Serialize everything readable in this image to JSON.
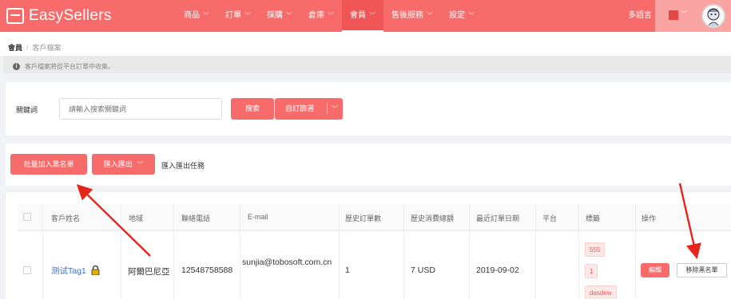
{
  "app": {
    "logo_text": "EasySellers"
  },
  "nav": {
    "items": [
      {
        "label": "商品"
      },
      {
        "label": "訂單"
      },
      {
        "label": "採購"
      },
      {
        "label": "倉庫"
      },
      {
        "label": "會員"
      },
      {
        "label": "售後服務"
      },
      {
        "label": "設定"
      }
    ],
    "active": "會員",
    "language_label": "多語言"
  },
  "breadcrumb": {
    "root": "會員",
    "separator": "/",
    "current": "客戶檔案"
  },
  "notice": {
    "icon": "info-icon",
    "text": "客戶檔案將從平台訂單中收集。"
  },
  "search": {
    "keyword_label": "關鍵詞",
    "keyword_placeholder": "請輸入搜索關鍵詞",
    "search_button": "搜索",
    "custom_filter_button": "自訂篩選"
  },
  "actions": {
    "blacklist_button": "批量加入黑名單",
    "import_export_button": "匯入匯出",
    "import_export_task": "匯入匯出任務"
  },
  "table": {
    "columns": [
      "客戶姓名",
      "地域",
      "聯絡電話",
      "E-mail",
      "歷史訂單數",
      "歷史消費總額",
      "最近訂單日期",
      "平台",
      "標籤",
      "操作"
    ],
    "rows": [
      {
        "name": "测试Tag1",
        "name_icon": "lock-icon",
        "region": "阿爾巴尼亞",
        "phone": "12548758588",
        "email": "sunjia@tobosoft.com.cn",
        "orders": "1",
        "total": "7 USD",
        "last_order": "2019-09-02",
        "platform": "",
        "tags": [
          "555",
          "1",
          "dasdew"
        ],
        "edit_label": "編輯",
        "remove_label": "移除黑名單"
      }
    ]
  },
  "colors": {
    "brand": "#f86b6b",
    "annotation": "#e8231a",
    "link": "#3a6fc4"
  }
}
